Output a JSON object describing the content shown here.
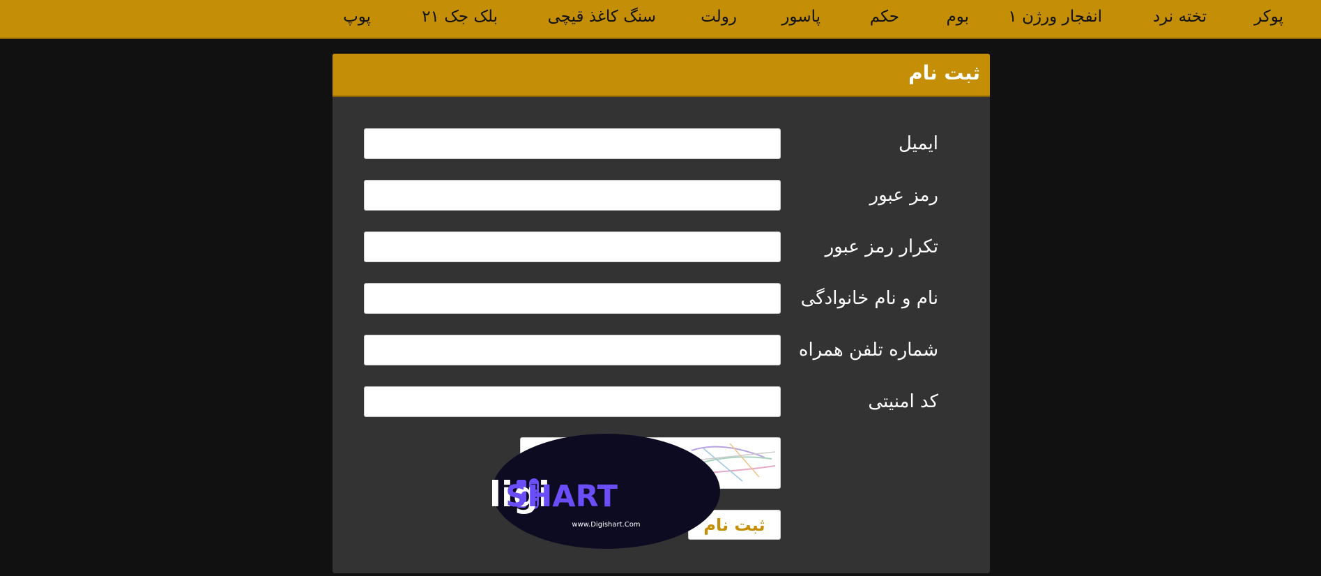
{
  "nav": {
    "items": [
      {
        "label": "پوکر"
      },
      {
        "label": "تخته نرد"
      },
      {
        "label": "انفجار ورژن ۱"
      },
      {
        "label": "بوم"
      },
      {
        "label": "حکم"
      },
      {
        "label": "پاسور"
      },
      {
        "label": "رولت"
      },
      {
        "label": "سنگ کاغذ قیچی"
      },
      {
        "label": "بلک جک ۲۱"
      },
      {
        "label": "پوپ"
      }
    ]
  },
  "form": {
    "title": "ثبت نام",
    "fields": [
      {
        "label": "ایمیل",
        "value": ""
      },
      {
        "label": "رمز عبور",
        "value": ""
      },
      {
        "label": "تکرار رمز عبور",
        "value": ""
      },
      {
        "label": "نام و نام خانوادگی",
        "value": ""
      },
      {
        "label": "شماره تلفن همراه",
        "value": ""
      },
      {
        "label": "کد امنیتی",
        "value": ""
      }
    ],
    "submit_label": "ثبت نام"
  },
  "logo": {
    "brand_left": "digi",
    "brand_right": "SHART",
    "url": "www.Digishart.Com"
  },
  "colors": {
    "accent": "#c48f07",
    "background": "#111111",
    "panel": "#333333",
    "logo_purple": "#6b4ef7",
    "logo_bg": "#0d0b21"
  },
  "icons": {
    "captcha": "captcha-image",
    "logo_mark": "digishart-logo-icon"
  }
}
